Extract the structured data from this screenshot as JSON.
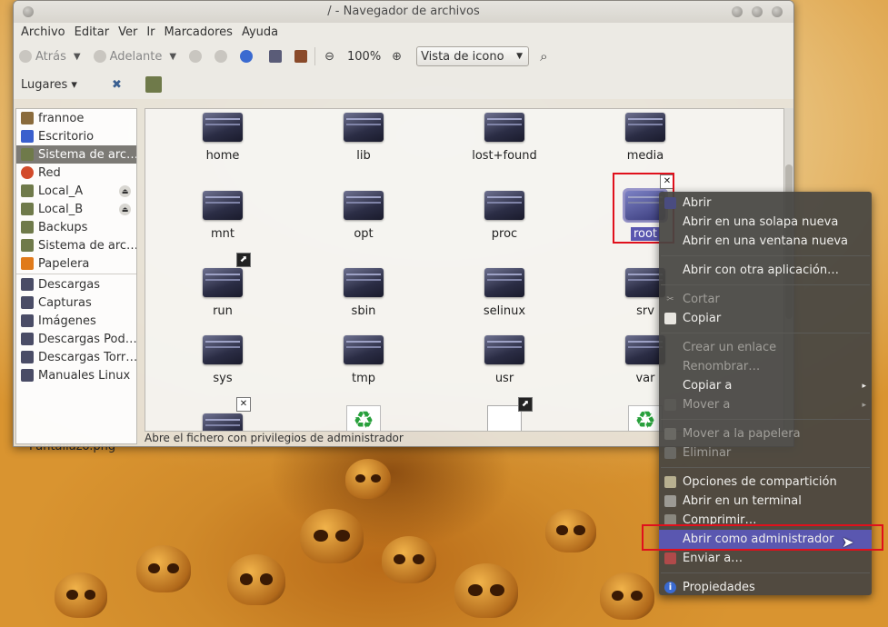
{
  "window": {
    "title": "/ - Navegador de archivos"
  },
  "menubar": [
    "Archivo",
    "Editar",
    "Ver",
    "Ir",
    "Marcadores",
    "Ayuda"
  ],
  "toolbar": {
    "back_label": "Atrás",
    "forward_label": "Adelante",
    "zoom_level": "100%",
    "view_mode": "Vista de icono",
    "dropdown_arrow": "▼"
  },
  "places": {
    "label": "Lugares ▾",
    "items": [
      {
        "label": "frannoe",
        "icon": "home-folder-icon",
        "color": "#8a6b3c"
      },
      {
        "label": "Escritorio",
        "icon": "desktop-icon",
        "color": "#3a5fcd"
      },
      {
        "label": "Sistema de arc…",
        "icon": "filesystem-icon",
        "color": "#6f7a4a"
      },
      {
        "label": "Red",
        "icon": "network-icon",
        "color": "#d24a2a"
      },
      {
        "label": "Local_A",
        "icon": "drive-icon",
        "color": "#6f7a4a",
        "eject": "⏏"
      },
      {
        "label": "Local_B",
        "icon": "drive-icon",
        "color": "#6f7a4a",
        "eject": "⏏"
      },
      {
        "label": "Backups",
        "icon": "drive-icon",
        "color": "#6f7a4a"
      },
      {
        "label": "Sistema de arc…",
        "icon": "filesystem-icon",
        "color": "#6f7a4a"
      },
      {
        "label": "Papelera",
        "icon": "trash-icon",
        "color": "#e07a1a"
      },
      {
        "label": "Descargas",
        "icon": "folder-icon",
        "color": "#4a4c66"
      },
      {
        "label": "Capturas",
        "icon": "folder-icon",
        "color": "#4a4c66"
      },
      {
        "label": "Imágenes",
        "icon": "folder-icon",
        "color": "#4a4c66"
      },
      {
        "label": "Descargas Pod…",
        "icon": "folder-icon",
        "color": "#4a4c66"
      },
      {
        "label": "Descargas Torr…",
        "icon": "folder-icon",
        "color": "#4a4c66"
      },
      {
        "label": "Manuales Linux",
        "icon": "folder-icon",
        "color": "#4a4c66"
      }
    ]
  },
  "folders": [
    {
      "label": "home"
    },
    {
      "label": "lib"
    },
    {
      "label": "lost+found"
    },
    {
      "label": "media"
    },
    {
      "label": "mnt"
    },
    {
      "label": "opt"
    },
    {
      "label": "proc"
    },
    {
      "label": "root"
    },
    {
      "label": "run"
    },
    {
      "label": "sbin"
    },
    {
      "label": "selinux"
    },
    {
      "label": "srv"
    },
    {
      "label": "sys"
    },
    {
      "label": "tmp"
    },
    {
      "label": "usr"
    },
    {
      "label": "var"
    }
  ],
  "badges": {
    "close": "✕",
    "link": "⬈",
    "recycle": "♻"
  },
  "status": "Abre el fichero con privilegios de administrador",
  "context_menu": {
    "items": [
      {
        "label": "Abrir",
        "disabled": false
      },
      {
        "label": "Abrir en una solapa nueva",
        "disabled": false
      },
      {
        "label": "Abrir en una ventana nueva",
        "disabled": false
      },
      {
        "label": "Abrir con otra aplicación…",
        "disabled": false
      },
      {
        "label": "Cortar",
        "disabled": true
      },
      {
        "label": "Copiar",
        "disabled": false
      },
      {
        "label": "Crear un enlace",
        "disabled": true
      },
      {
        "label": "Renombrar…",
        "disabled": true
      },
      {
        "label": "Copiar a",
        "disabled": false
      },
      {
        "label": "Mover a",
        "disabled": true
      },
      {
        "label": "Mover a la papelera",
        "disabled": true
      },
      {
        "label": "Eliminar",
        "disabled": true
      },
      {
        "label": "Opciones de compartición",
        "disabled": false
      },
      {
        "label": "Abrir en un terminal",
        "disabled": false
      },
      {
        "label": "Comprimir…",
        "disabled": false
      },
      {
        "label": "Abrir como administrador",
        "disabled": false,
        "highlighted": true
      },
      {
        "label": "Enviar a…",
        "disabled": false
      },
      {
        "label": "Propiedades",
        "disabled": false
      }
    ],
    "submenu_arrow": "▸"
  },
  "desktop": {
    "icon_label": "Pantallazo.png"
  },
  "colors": {
    "highlight": "#5a57b0",
    "annotation": "#e0101c",
    "selection": "#7c7a75"
  }
}
